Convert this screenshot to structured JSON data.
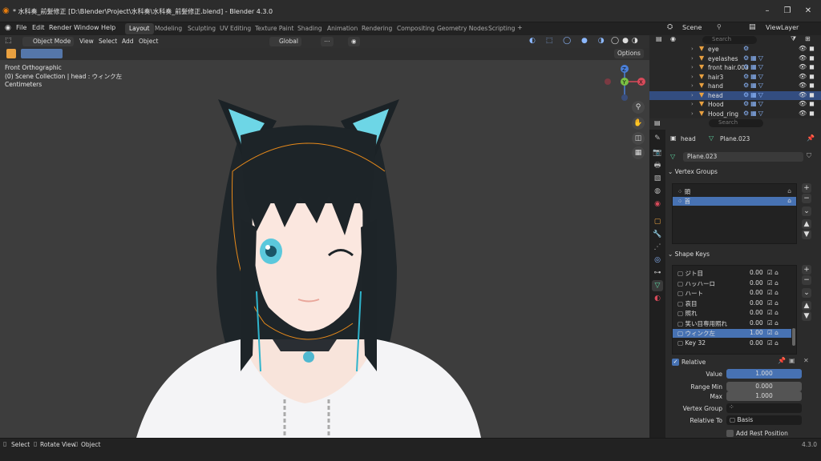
{
  "window": {
    "title": "* 水科奏_前髪修正 [D:\\Blender\\Project\\水科奏\\水科奏_前髪修正.blend] - Blender 4.3.0"
  },
  "menu": [
    "File",
    "Edit",
    "Render",
    "Window",
    "Help"
  ],
  "workspaces": [
    "Layout",
    "Modeling",
    "Sculpting",
    "UV Editing",
    "Texture Paint",
    "Shading",
    "Animation",
    "Rendering",
    "Compositing",
    "Geometry Nodes",
    "Scripting"
  ],
  "active_workspace": "Layout",
  "scene": "Scene",
  "view_layer": "ViewLayer",
  "viewport": {
    "mode": "Object Mode",
    "menus": [
      "View",
      "Select",
      "Add",
      "Object"
    ],
    "transform": "Global",
    "options": "Options",
    "info": [
      "Front Orthographic",
      "(0) Scene Collection | head : ウィンク左",
      "Centimeters"
    ],
    "axes": {
      "z": "Z",
      "y": "Y",
      "x": "X"
    }
  },
  "outliner": {
    "search_placeholder": "Search",
    "rows": [
      "eye",
      "eyelashes",
      "front hair.003",
      "hair3",
      "hand",
      "head",
      "Hood",
      "Hood_ring"
    ],
    "selected": "head"
  },
  "properties": {
    "search_placeholder": "Search",
    "object": "head",
    "mesh": "Plane.023",
    "mesh_field": "Plane.023",
    "vertex_groups": {
      "title": "Vertex Groups",
      "items": [
        "頭",
        "首"
      ],
      "selected": 1
    },
    "shape_keys": {
      "title": "Shape Keys",
      "items": [
        {
          "name": "ジト目",
          "value": "0.00"
        },
        {
          "name": "ハッハーロ",
          "value": "0.00"
        },
        {
          "name": "ハート",
          "value": "0.00"
        },
        {
          "name": "哀目",
          "value": "0.00"
        },
        {
          "name": "照れ",
          "value": "0.00"
        },
        {
          "name": "笑い目専用照れ",
          "value": "0.00"
        },
        {
          "name": "ウィンク左",
          "value": "1.00"
        },
        {
          "name": "Key 32",
          "value": "0.00"
        }
      ],
      "selected": 6
    },
    "relative_label": "Relative",
    "value_label": "Value",
    "value": "1.000",
    "value_fill": 1.0,
    "range_min_label": "Range Min",
    "range_min": "0.000",
    "max_label": "Max",
    "max": "1.000",
    "vertex_group_label": "Vertex Group",
    "vertex_group": "",
    "relative_to_label": "Relative To",
    "relative_to": "Basis",
    "add_rest_label": "Add Rest Position"
  },
  "status": {
    "items": [
      "Select",
      "Rotate View",
      "Object"
    ],
    "version": "4.3.0"
  }
}
